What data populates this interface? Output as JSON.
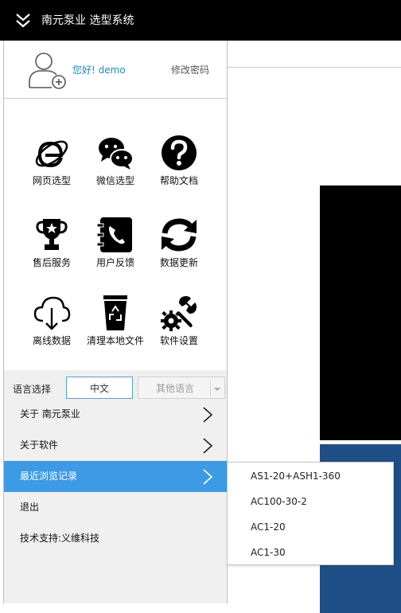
{
  "app": {
    "title": "南元泵业 选型系统"
  },
  "user": {
    "greeting": "您好!  demo",
    "change_password": "修改密码"
  },
  "tiles": [
    {
      "label": "网页选型",
      "icon": "ie-browser-icon"
    },
    {
      "label": "微信选型",
      "icon": "wechat-icon"
    },
    {
      "label": "帮助文档",
      "icon": "help-icon"
    },
    {
      "label": "售后服务",
      "icon": "trophy-icon"
    },
    {
      "label": "用户反馈",
      "icon": "phone-book-icon"
    },
    {
      "label": "数据更新",
      "icon": "refresh-icon"
    },
    {
      "label": "离线数据",
      "icon": "cloud-download-icon"
    },
    {
      "label": "清理本地文件",
      "icon": "trash-icon"
    },
    {
      "label": "软件设置",
      "icon": "settings-tools-icon"
    }
  ],
  "language": {
    "label": "语言选择",
    "selected": "中文",
    "other": "其他语言"
  },
  "menu": [
    {
      "label": "关于 南元泵业",
      "has_arrow": true
    },
    {
      "label": "关于软件",
      "has_arrow": true
    },
    {
      "label": "最近浏览记录",
      "has_arrow": true,
      "active": true
    },
    {
      "label": "退出",
      "has_arrow": false
    },
    {
      "label": "技术支持:义维科技",
      "has_arrow": false
    }
  ],
  "recent": [
    "AS1-20+ASH1-360",
    "AC100-30-2",
    "AC1-20",
    "AC1-30"
  ],
  "colors": {
    "accent": "#3d9be5",
    "link": "#1a8bc4",
    "titlebar": "#000000"
  }
}
